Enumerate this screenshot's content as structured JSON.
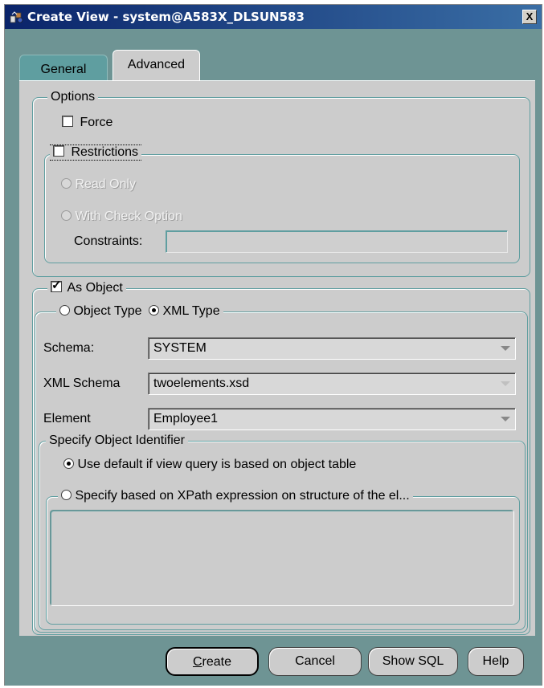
{
  "window": {
    "title": "Create View - system@A583X_DLSUN583",
    "close_label": "X"
  },
  "tabs": [
    {
      "label": "General",
      "selected": false
    },
    {
      "label": "Advanced",
      "selected": true
    }
  ],
  "options": {
    "legend": "Options",
    "force_label": "Force",
    "force_checked": false,
    "restrictions_label": "Restrictions",
    "restrictions_checked": false,
    "read_only_label": "Read Only",
    "check_option_label": "With Check Option",
    "constraints_label": "Constraints:",
    "constraints_value": ""
  },
  "as_object": {
    "label": "As Object",
    "checked": true,
    "object_type_label": "Object Type",
    "xml_type_label": "XML Type",
    "selected_type": "XML Type",
    "schema_label": "Schema:",
    "schema_value": "SYSTEM",
    "xml_schema_label": "XML Schema",
    "xml_schema_value": "twoelements.xsd",
    "element_label": "Element",
    "element_value": "Employee1"
  },
  "identifier": {
    "legend": "Specify Object Identifier",
    "use_default_label": "Use default if view query is based on object table",
    "xpath_label": "Specify based on XPath expression on structure of the el...",
    "selected": "use_default"
  },
  "buttons": {
    "create": "Create",
    "cancel": "Cancel",
    "show_sql": "Show SQL",
    "help": "Help"
  },
  "colors": {
    "title_bar": "#0a246a",
    "frame": "#6e9494",
    "panel": "#cccccc",
    "group_border": "#5f9ea0"
  }
}
